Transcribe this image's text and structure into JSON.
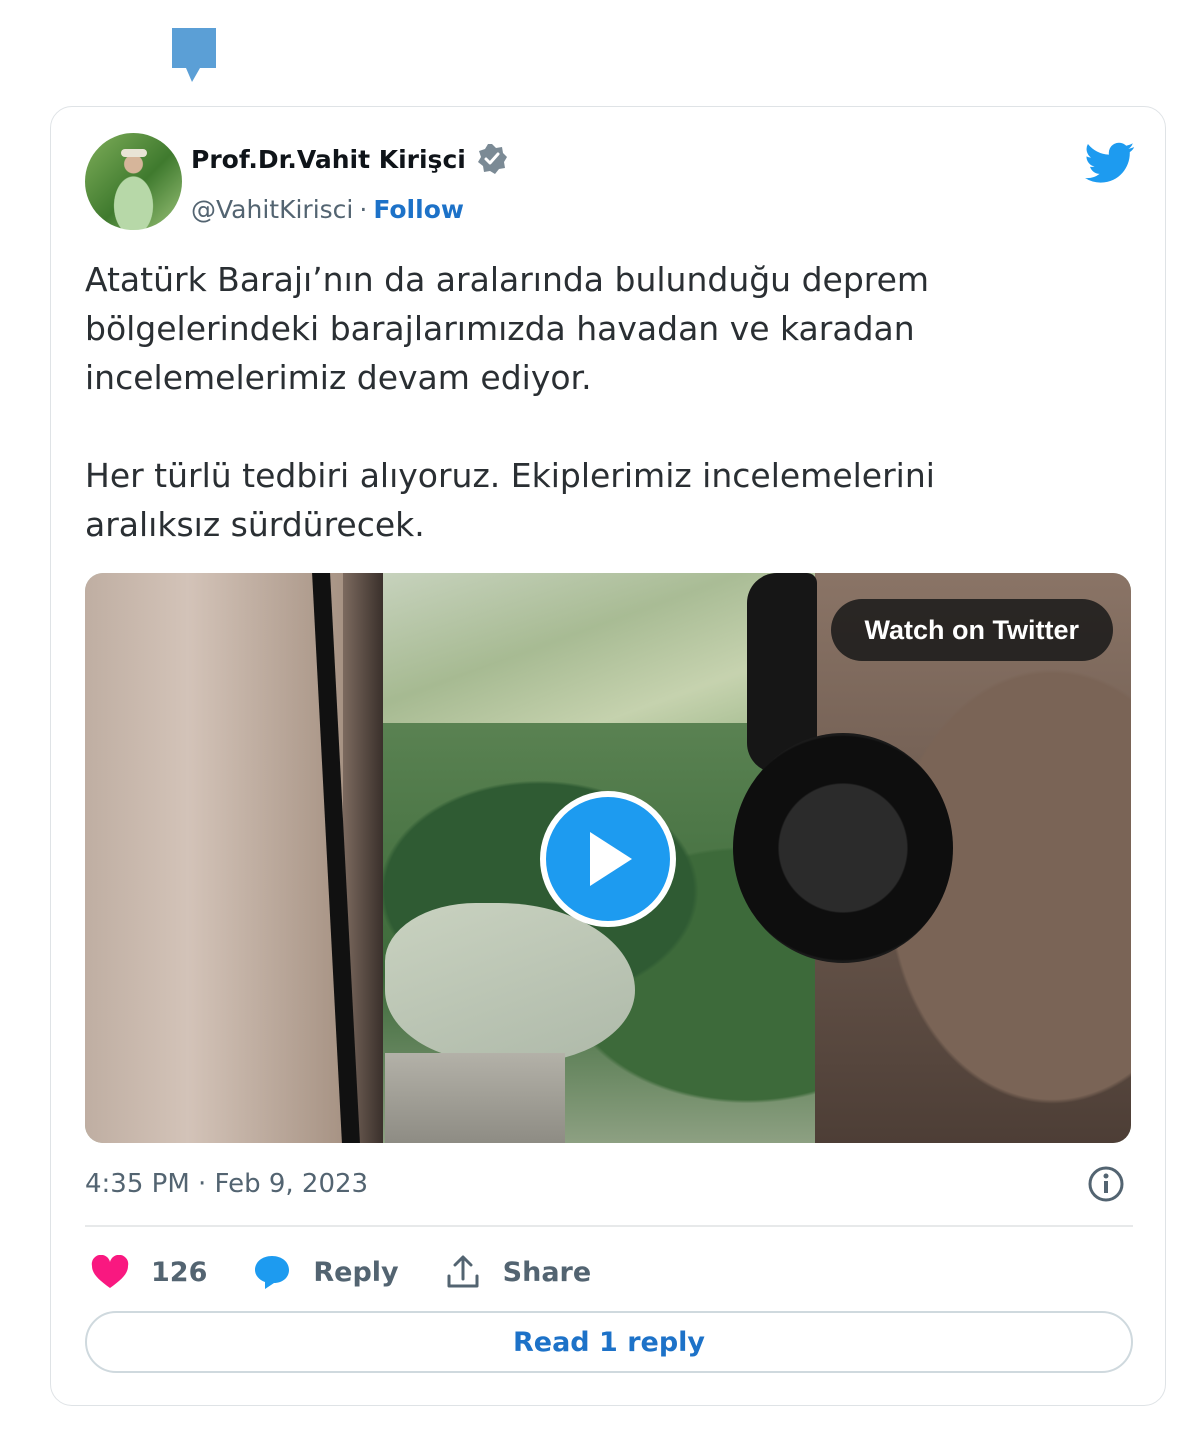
{
  "author": {
    "name": "Prof.Dr.Vahit Kirişci",
    "handle": "@VahitKirisci",
    "separator": "·",
    "follow_label": "Follow"
  },
  "tweet": {
    "paragraph1": "Atatürk Barajı’nın da aralarında bulunduğu deprem bölgelerindeki barajlarımızda havadan ve karadan incelemelerimiz devam ediyor.",
    "paragraph2": "Her türlü tedbiri alıyoruz. Ekiplerimiz incelemelerini aralıksız sürdürecek."
  },
  "media": {
    "watch_label": "Watch on Twitter"
  },
  "timestamp": "4:35 PM · Feb 9, 2023",
  "actions": {
    "like_count": "126",
    "reply_label": "Reply",
    "share_label": "Share"
  },
  "read_replies_label": "Read 1 reply",
  "colors": {
    "accent": "#1d9bf0",
    "link": "#1d72c8",
    "like": "#f91880",
    "muted": "#536471"
  },
  "icons": [
    "speech-bubble-icon",
    "verified-badge-icon",
    "twitter-bird-icon",
    "play-icon",
    "info-icon",
    "heart-icon",
    "reply-icon",
    "share-icon"
  ]
}
